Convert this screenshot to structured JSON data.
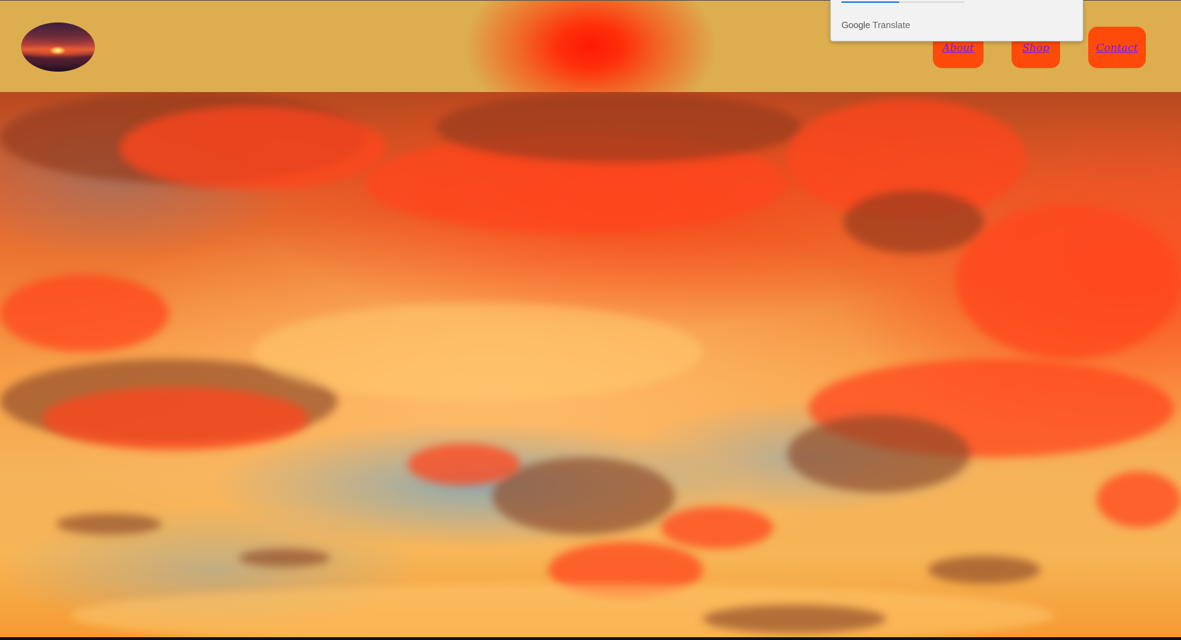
{
  "header": {
    "logo_alt": "",
    "nav": [
      {
        "label": "About"
      },
      {
        "label": "Shop"
      },
      {
        "label": "Contact"
      }
    ]
  },
  "colors": {
    "header_bg": "#dcae4f",
    "nav_button_bg": "#ff4a0a",
    "nav_text": "#6a1bff",
    "header_glow": "#ff1a05"
  },
  "translate_popup": {
    "brand_google": "Google",
    "brand_translate": "Translate",
    "progress": 0.47
  },
  "hero": {
    "image": "sunset-sky"
  }
}
